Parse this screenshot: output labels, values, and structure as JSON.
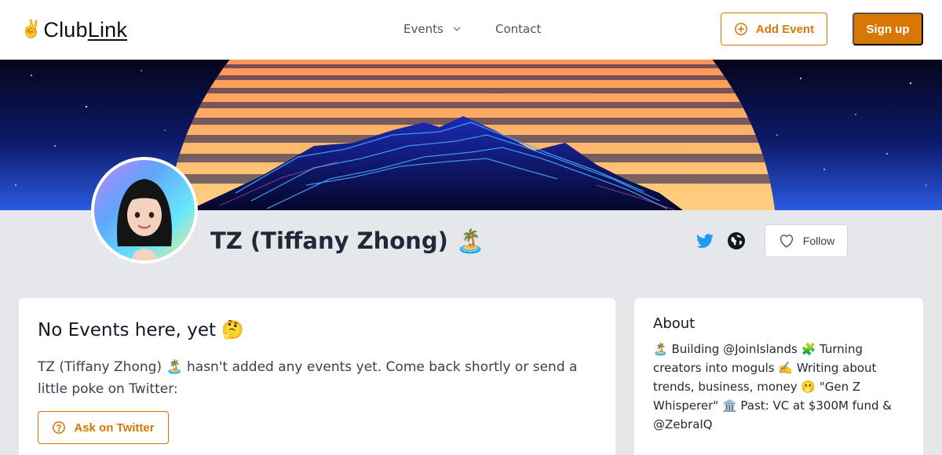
{
  "header": {
    "logo_hand": "✌️",
    "logo_text_a": "Club",
    "logo_text_b": "Link",
    "nav": {
      "events_label": "Events",
      "contact_label": "Contact"
    },
    "add_event_label": "Add Event",
    "signup_label": "Sign up"
  },
  "profile": {
    "name": "TZ (Tiffany Zhong) 🏝️",
    "follow_label": "Follow"
  },
  "events_card": {
    "title": "No Events here, yet 🤔",
    "message": "TZ (Tiffany Zhong) 🏝️ hasn't added any events yet. Come back shortly or send a little poke on Twitter:",
    "ask_label": "Ask on Twitter"
  },
  "about_card": {
    "title": "About",
    "bio": "🏝️ Building @JoinIslands 🧩 Turning creators into moguls ✍️ Writing about trends, business, money 🫢 \"Gen Z Whisperer\" 🏛️ Past: VC at $300M fund & @ZebraIQ"
  },
  "colors": {
    "accent": "#d97706",
    "twitter": "#1d9bf0",
    "page_bg": "#e5e7eb"
  },
  "icons": [
    "chevron-down-icon",
    "plus-circle-icon",
    "twitter-icon",
    "globe-icon",
    "heart-icon",
    "question-circle-icon"
  ]
}
